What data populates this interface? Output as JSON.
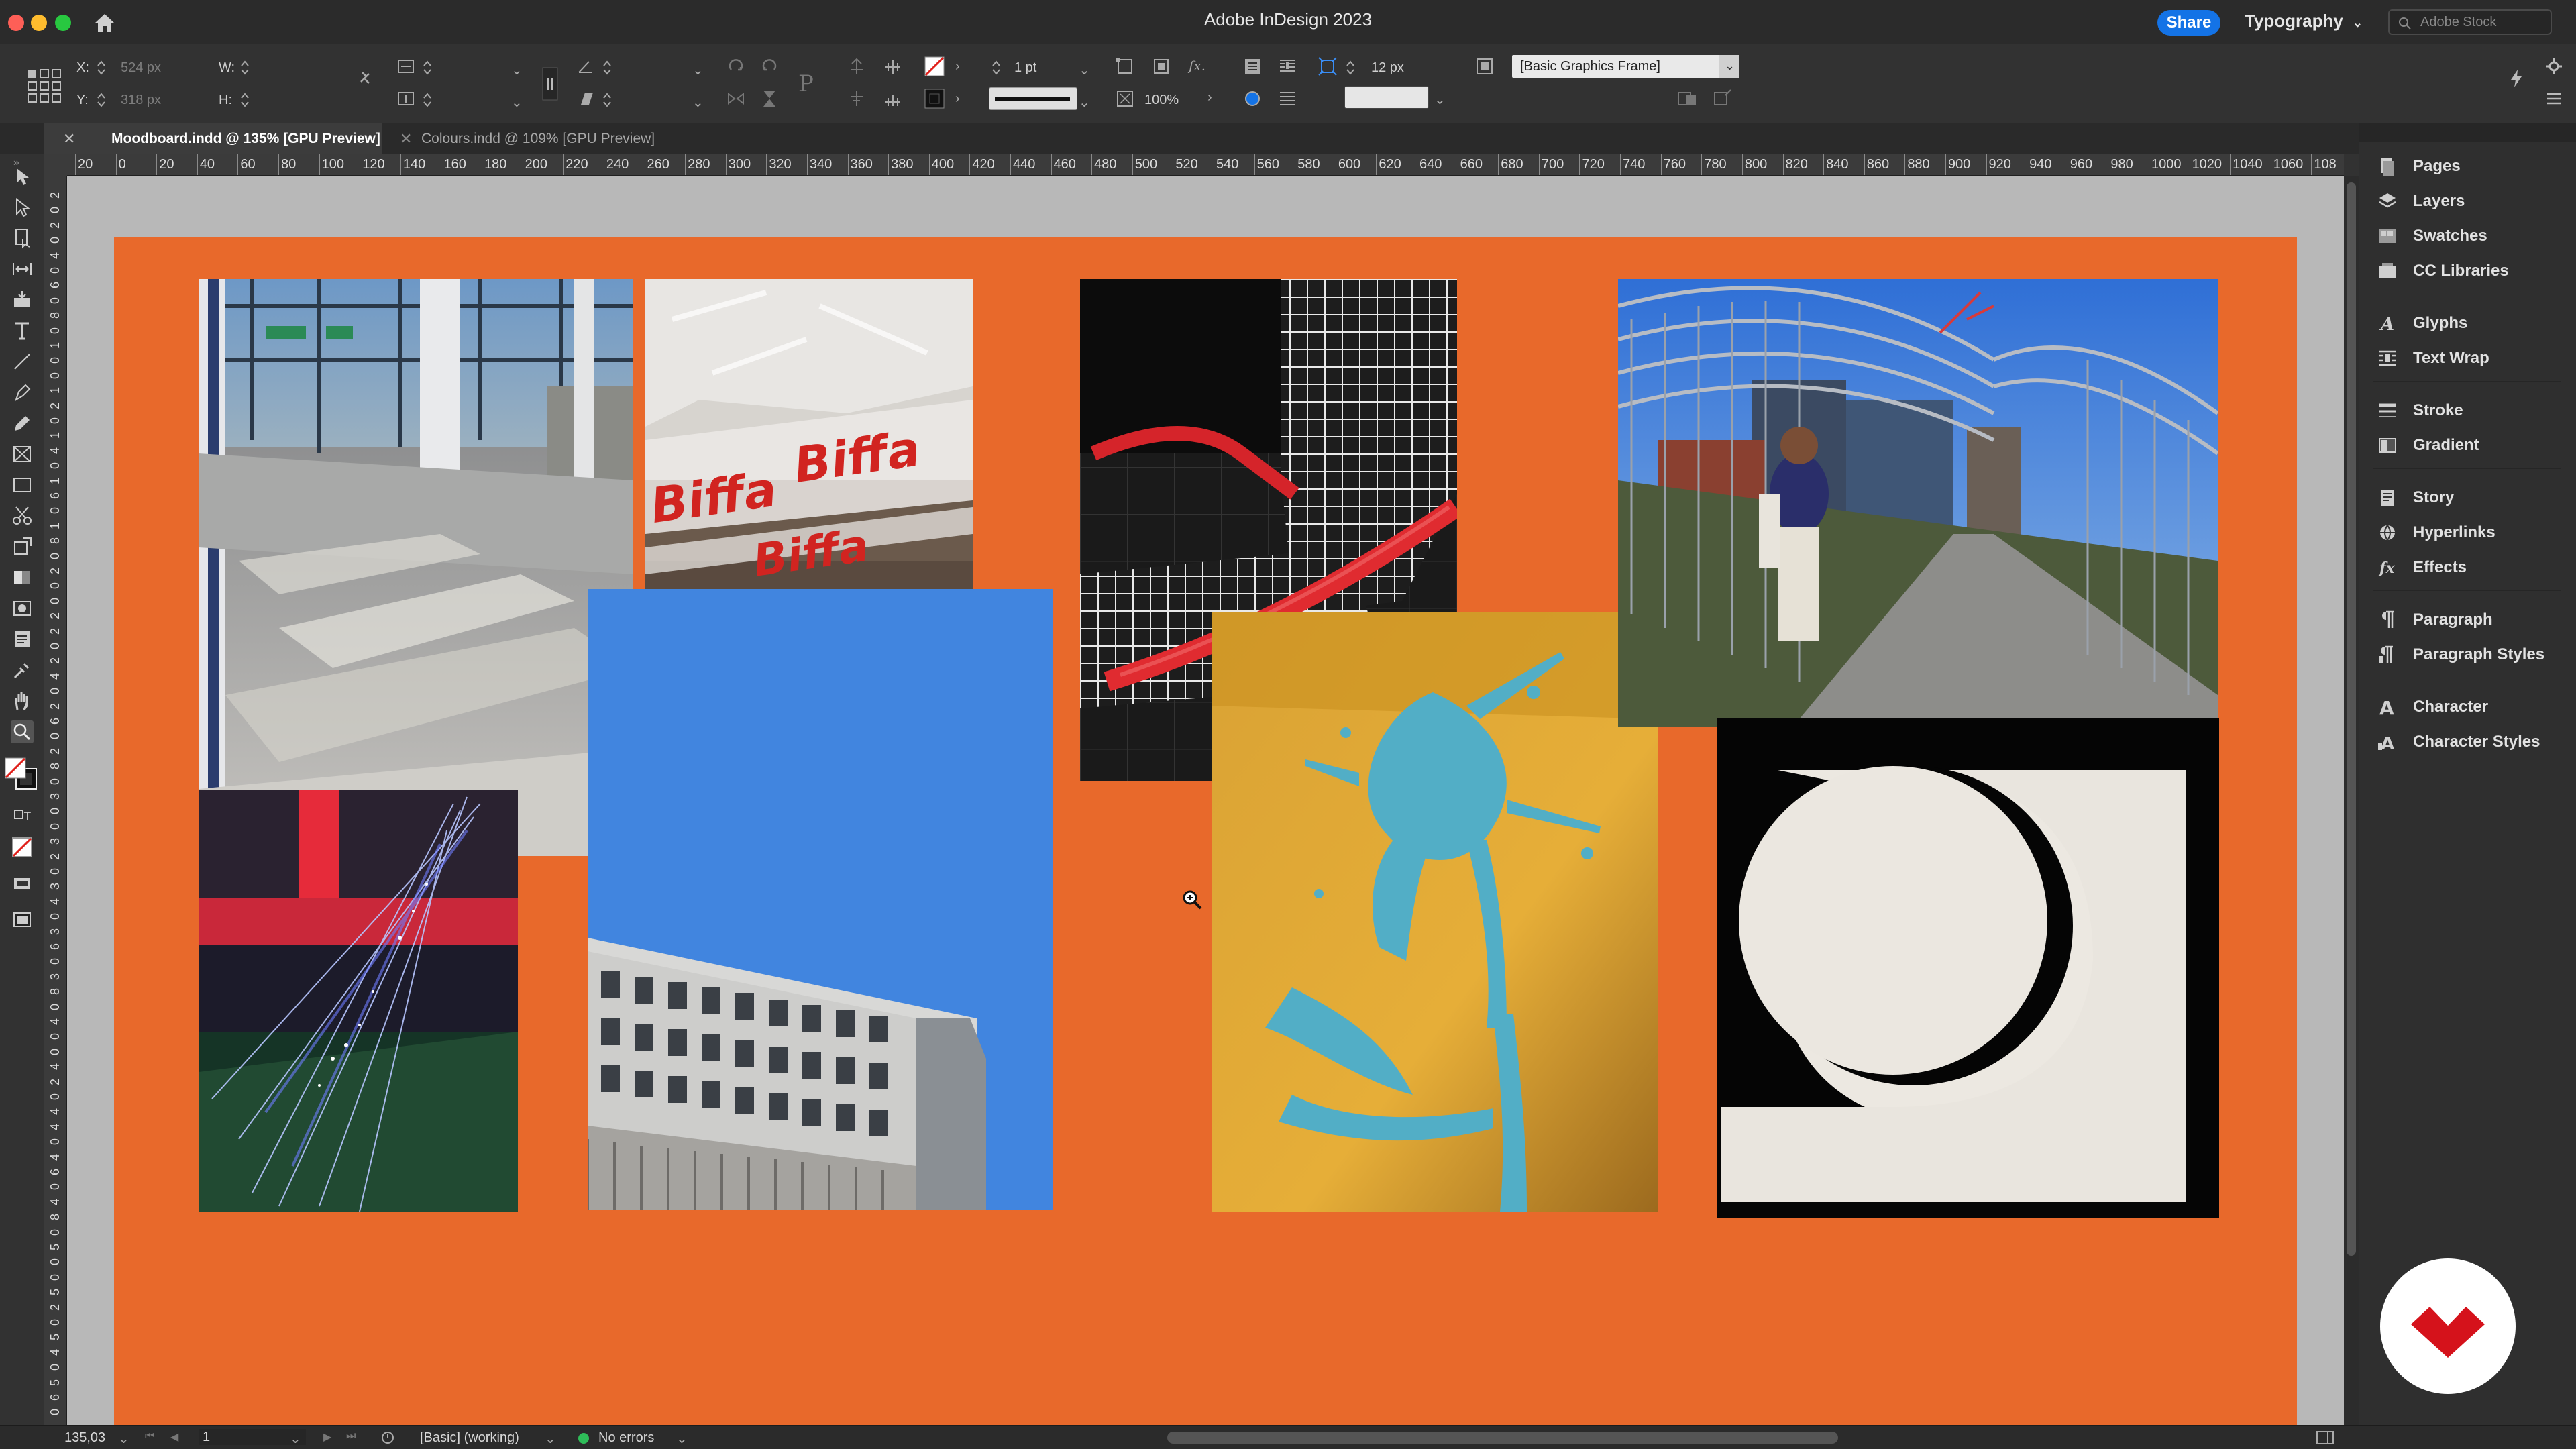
{
  "titlebar": {
    "app_title": "Adobe InDesign 2023",
    "share_label": "Share",
    "workspace_label": "Typography",
    "stock_placeholder": "Adobe Stock"
  },
  "controlbar": {
    "x_label": "X:",
    "x_value": "524 px",
    "y_label": "Y:",
    "y_value": "318 px",
    "w_label": "W:",
    "h_label": "H:",
    "stroke_weight": "1 pt",
    "opacity": "100%",
    "fitting_value": "12 px",
    "frame_style": "[Basic Graphics Frame]",
    "fx_label": "fx."
  },
  "tabs": [
    {
      "label": "Moodboard.indd @ 135% [GPU Preview]",
      "active": true
    },
    {
      "label": "Colours.indd @ 109% [GPU Preview]",
      "active": false
    }
  ],
  "ruler": {
    "h_labels": [
      "20",
      "0",
      "20",
      "40",
      "60",
      "80",
      "100",
      "120",
      "140",
      "160",
      "180",
      "200",
      "220",
      "240",
      "260",
      "280",
      "300",
      "320",
      "340",
      "360",
      "380",
      "400",
      "420",
      "440",
      "460",
      "480",
      "500",
      "520",
      "540",
      "560",
      "580",
      "600",
      "620",
      "640",
      "660",
      "680",
      "700",
      "720",
      "740",
      "760",
      "780",
      "800",
      "820",
      "840",
      "860",
      "880",
      "900",
      "920",
      "940",
      "960",
      "980",
      "1000",
      "1020",
      "1040",
      "1060",
      "108"
    ],
    "v_labels": [
      "2",
      "0",
      "2",
      "0",
      "4",
      "0",
      "6",
      "0",
      "8",
      "0",
      "1",
      "0",
      "0",
      "1",
      "2",
      "0",
      "1",
      "4",
      "0",
      "1",
      "6",
      "0",
      "1",
      "8",
      "0",
      "2",
      "0",
      "0",
      "2",
      "2",
      "0",
      "2",
      "4",
      "0",
      "2",
      "6",
      "0",
      "2",
      "8",
      "0",
      "3",
      "0",
      "0",
      "3",
      "2",
      "0",
      "3",
      "4",
      "0",
      "3",
      "6",
      "0",
      "3",
      "8",
      "0",
      "4",
      "0",
      "0",
      "4",
      "2",
      "0",
      "4",
      "4",
      "0",
      "4",
      "6",
      "0",
      "4",
      "8",
      "0",
      "5",
      "0",
      "0",
      "5",
      "2",
      "0",
      "5",
      "4",
      "0",
      "5",
      "6",
      "0"
    ]
  },
  "panels": [
    {
      "label": "Pages",
      "icon": "pages-icon"
    },
    {
      "label": "Layers",
      "icon": "layers-icon"
    },
    {
      "label": "Swatches",
      "icon": "swatches-icon"
    },
    {
      "label": "CC Libraries",
      "icon": "cc-libraries-icon"
    },
    {
      "label": "Glyphs",
      "icon": "glyphs-icon"
    },
    {
      "label": "Text Wrap",
      "icon": "text-wrap-icon"
    },
    {
      "label": "Stroke",
      "icon": "stroke-icon"
    },
    {
      "label": "Gradient",
      "icon": "gradient-icon"
    },
    {
      "label": "Story",
      "icon": "story-icon"
    },
    {
      "label": "Hyperlinks",
      "icon": "hyperlinks-icon"
    },
    {
      "label": "Effects",
      "icon": "effects-icon"
    },
    {
      "label": "Paragraph",
      "icon": "paragraph-icon"
    },
    {
      "label": "Paragraph Styles",
      "icon": "paragraph-styles-icon"
    },
    {
      "label": "Character",
      "icon": "character-icon"
    },
    {
      "label": "Character Styles",
      "icon": "character-styles-icon"
    }
  ],
  "photos": {
    "biffa_text": "Biffa"
  },
  "status": {
    "zoom": "135,03",
    "page_number": "1",
    "preflight_profile": "[Basic] (working)",
    "errors": "No errors"
  },
  "colors": {
    "page_bg": "#e8692b",
    "accent": "#1473e6",
    "logo_red": "#d5121b"
  }
}
